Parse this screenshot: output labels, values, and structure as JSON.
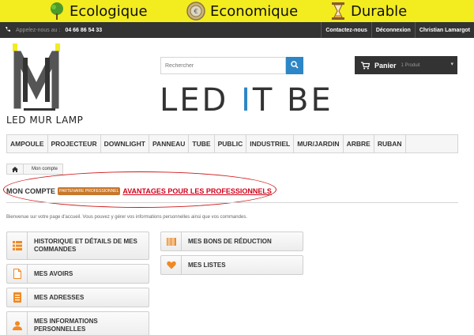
{
  "banner": {
    "items": [
      {
        "label": "Ecologique",
        "icon": "tree-icon"
      },
      {
        "label": "Economique",
        "icon": "euro-coin-icon"
      },
      {
        "label": "Durable",
        "icon": "hourglass-icon"
      }
    ]
  },
  "topbar": {
    "phone_label": "Appelez-nous au :",
    "phone_number": "04 66 86 54 33",
    "links": [
      "Contactez-nous",
      "Déconnexion",
      "Christian Lamargot"
    ]
  },
  "logo": {
    "brand_text": "LED MUR LAMP"
  },
  "search": {
    "placeholder": "Rechercher"
  },
  "cart": {
    "label": "Panier",
    "count": "1 Produit"
  },
  "slogan": {
    "p1": "LED ",
    "p2": "I",
    "p3": "T BE"
  },
  "menu": [
    "AMPOULE",
    "PROJECTEUR",
    "DOWNLIGHT",
    "PANNEAU",
    "TUBE",
    "PUBLIC",
    "INDUSTRIEL",
    "MUR/JARDIN",
    "ARBRE",
    "RUBAN"
  ],
  "breadcrumb": {
    "current": "Mon compte"
  },
  "heading": {
    "title": "MON COMPTE",
    "badge": "PARTENAIRE PROFESSIONNEL",
    "link": "AVANTAGES POUR LES PROFESSIONNELS"
  },
  "intro": "Bienvenue sur votre page d'accueil. Vous pouvez y gérer vos informations personnelles ainsi que vos commandes.",
  "account_left": [
    {
      "l1": "HISTORIQUE ET DÉTAILS DE MES",
      "l2": "COMMANDES",
      "icon": "list-icon"
    },
    {
      "l1": "MES AVOIRS",
      "l2": "",
      "icon": "document-icon"
    },
    {
      "l1": "MES ADRESSES",
      "l2": "",
      "icon": "address-book-icon"
    },
    {
      "l1": "MES INFORMATIONS",
      "l2": "PERSONNELLES",
      "icon": "user-icon"
    }
  ],
  "account_right": [
    {
      "l1": "MES BONS DE RÉDUCTION",
      "icon": "barcode-icon"
    },
    {
      "l1": "MES LISTES",
      "icon": "heart-icon"
    }
  ],
  "colors": {
    "accent": "#2d86c5",
    "banner": "#f3ec1f",
    "icon_orange": "#f08a24",
    "highlight_red": "#d01818"
  }
}
